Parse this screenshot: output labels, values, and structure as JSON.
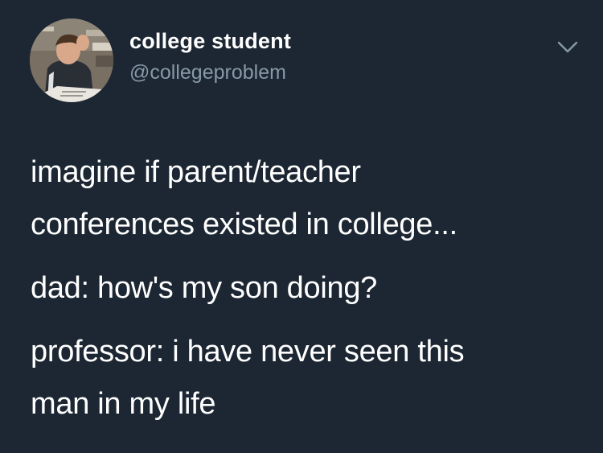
{
  "tweet": {
    "author": {
      "display_name": "college student",
      "handle": "@collegeproblem"
    },
    "menu_icon": "chevron-down-icon",
    "text_lines": [
      "imagine if parent/teacher",
      "conferences existed in college...",
      "dad: how's my son doing?",
      "professor: i have never seen this",
      "man in my life"
    ]
  },
  "colors": {
    "background": "#1c2733",
    "primary_text": "#ffffff",
    "secondary_text": "#8899a6"
  }
}
